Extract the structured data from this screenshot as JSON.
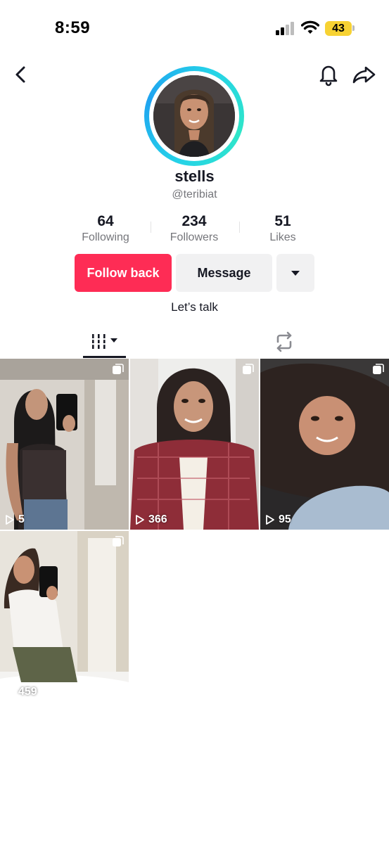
{
  "status_bar": {
    "time": "8:59",
    "battery": "43"
  },
  "profile": {
    "display_name": "stells",
    "username": "@teribiat",
    "bio": "Let’s talk",
    "stats": {
      "following": {
        "value": "64",
        "label": "Following"
      },
      "followers": {
        "value": "234",
        "label": "Followers"
      },
      "likes": {
        "value": "51",
        "label": "Likes"
      }
    }
  },
  "actions": {
    "follow_label": "Follow back",
    "message_label": "Message"
  },
  "tabs": [
    {
      "name": "videos",
      "icon": "grid-icon",
      "selected": true
    },
    {
      "name": "reposts",
      "icon": "repost-icon",
      "selected": false
    }
  ],
  "videos": [
    {
      "views": "5",
      "icon": "play-icon"
    },
    {
      "views": "366",
      "icon": "play-icon"
    },
    {
      "views": "95",
      "icon": "play-icon"
    },
    {
      "views": "459",
      "icon": "play-icon"
    }
  ],
  "colors": {
    "accent": "#fe2c55",
    "ring": "#25d2e8",
    "battery": "#f7d233"
  }
}
